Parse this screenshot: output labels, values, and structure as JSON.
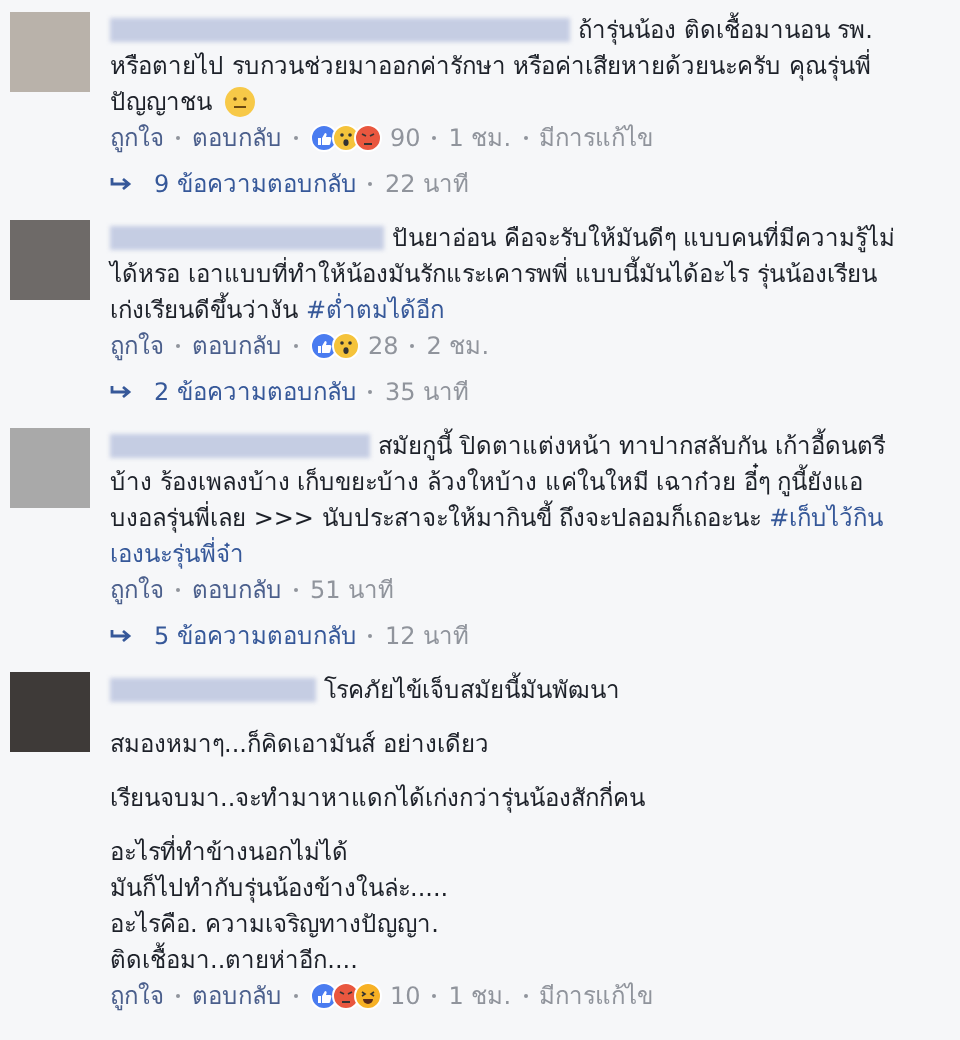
{
  "comments": [
    {
      "paragraphs": [
        [
          {
            "text": "ถ้ารุ่นน้อง ติดเชื้อมานอน รพ."
          },
          {
            "text": "หรือตายไป รบกวนช่วยมาออกค่ารักษา หรือค่าเสียหายด้วยนะครับ คุณรุ่นพี่"
          },
          {
            "text": "ปัญญาชน",
            "emoji": true
          }
        ]
      ],
      "reactions": [
        {
          "kind": "like"
        },
        {
          "kind": "wow"
        },
        {
          "kind": "angry"
        }
      ],
      "count": "90",
      "actions": [
        "ถูกใจ",
        "ตอบกลับ"
      ],
      "time": "1 ชม.",
      "edited": "มีการแก้ไข",
      "replies": {
        "label": "9 ข้อความตอบกลับ",
        "time": "22 นาที"
      }
    },
    {
      "paragraphs": [
        [
          {
            "text": "ปันยาอ่อน คือจะรับให้มันดีๆ แบบคนที่มีความรู้ไม่"
          },
          {
            "text": "ได้หรอ เอาแบบที่ทำให้น้องมันรักแระเคารพพี่ แบบนี้มันได้อะไร รุ่นน้องเรียน"
          },
          {
            "text": "เก่งเรียนดีขึ้นว่างัน",
            "hashtag": "#ต่ำตมได้อีก"
          }
        ]
      ],
      "reactions": [
        {
          "kind": "like"
        },
        {
          "kind": "wow"
        }
      ],
      "count": "28",
      "actions": [
        "ถูกใจ",
        "ตอบกลับ"
      ],
      "time": "2 ชม.",
      "replies": {
        "label": "2 ข้อความตอบกลับ",
        "time": "35 นาที"
      }
    },
    {
      "paragraphs": [
        [
          {
            "text": "สมัยกูนี้ ปิดตาแต่งหน้า ทาปากสลับกัน เก้าอี้ดนตรี"
          },
          {
            "text": "บ้าง ร้องเพลงบ้าง เก็บขยะบ้าง ล้วงใหบ้าง แค่ในใหมี เฉาก๋วย อี๋ๆ กูนี้ยังแอ"
          },
          {
            "text": "บงอลรุ่นพี่เลย >>> นับประสาจะให้มากินขี้ ถึงจะปลอมก็เถอะนะ",
            "hashtag": "#เก็บไว้กิน"
          },
          {
            "hashtag": "เองนะรุ่นพี่จ๋า"
          }
        ]
      ],
      "actions": [
        "ถูกใจ",
        "ตอบกลับ"
      ],
      "time": "51 นาที",
      "replies": {
        "label": "5 ข้อความตอบกลับ",
        "time": "12 นาที"
      }
    },
    {
      "paragraphs": [
        [
          {
            "text": "โรคภัยไข้เจ็บสมัยนี้มันพัฒนา"
          }
        ],
        [
          {
            "text": "สมองหมาๆ...ก็คิดเอามันส์ อย่างเดียว"
          }
        ],
        [
          {
            "text": "เรียนจบมา..จะทำมาหาแดกได้เก่งกว่ารุ่นน้องสักกี่คน"
          }
        ],
        [
          {
            "text": "อะไรที่ทำข้างนอกไม่ได้"
          },
          {
            "text": "มันก็ไปทำกับรุ่นน้องข้างในล่ะ....."
          },
          {
            "text": "อะไรคือ. ความเจริญทางปัญญา."
          },
          {
            "text": "ติดเชื้อมา..ตายห่าอีก...."
          }
        ]
      ],
      "reactions": [
        {
          "kind": "like"
        },
        {
          "kind": "angry"
        },
        {
          "kind": "haha"
        }
      ],
      "count": "10",
      "actions": [
        "ถูกใจ",
        "ตอบกลับ"
      ],
      "time": "1 ชม.",
      "edited": "มีการแก้ไข"
    }
  ]
}
